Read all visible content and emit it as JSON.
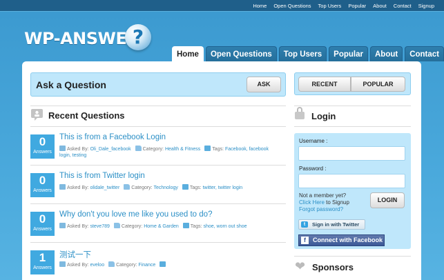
{
  "topnav": [
    "Home",
    "Open Questions",
    "Top Users",
    "Popular",
    "About",
    "Contact",
    "Signup"
  ],
  "logo": {
    "text": "WP-ANSWERS",
    "mark": "?"
  },
  "mainnav": [
    {
      "label": "Home",
      "active": true
    },
    {
      "label": "Open Questions",
      "active": false
    },
    {
      "label": "Top Users",
      "active": false
    },
    {
      "label": "Popular",
      "active": false
    },
    {
      "label": "About",
      "active": false
    },
    {
      "label": "Contact",
      "active": false
    }
  ],
  "ask": {
    "title": "Ask a Question",
    "button": "ASK"
  },
  "recent": {
    "heading": "Recent Questions"
  },
  "questions": [
    {
      "count": "0",
      "count_label": "Answers",
      "title": "This is from a Facebook Login",
      "asked_by_label": "Asked By:",
      "user": "Oli_Dale_facebook",
      "category_label": "Category:",
      "category": "Health & Fitness",
      "tags_label": "Tags:",
      "tags": "Facebook, facebook login, testing"
    },
    {
      "count": "0",
      "count_label": "Answers",
      "title": "This is from Twitter login",
      "asked_by_label": "Asked By:",
      "user": "olidale_twitter",
      "category_label": "Category:",
      "category": "Technology",
      "tags_label": "Tags:",
      "tags": "twitter, twitter login"
    },
    {
      "count": "0",
      "count_label": "Answers",
      "title": "Why don't you love me like you used to do?",
      "asked_by_label": "Asked By:",
      "user": "steve789",
      "category_label": "Category:",
      "category": "Home & Garden",
      "tags_label": "Tags:",
      "tags": "shoe, worn out shoe"
    },
    {
      "count": "1",
      "count_label": "Answers",
      "title": "测试一下",
      "asked_by_label": "Asked By:",
      "user": "eveloo",
      "category_label": "Category:",
      "category": "Finance",
      "tags_label": "",
      "tags": ""
    }
  ],
  "sidebar": {
    "tabs": {
      "recent": "RECENT",
      "popular": "POPULAR"
    },
    "login": {
      "heading": "Login",
      "username_label": "Username :",
      "password_label": "Password :",
      "not_member": "Not a member yet?",
      "click_here": "Click Here",
      "to_signup": " to Signup",
      "forgot": "Forgot password?",
      "login_button": "LOGIN",
      "twitter": "Sign in with Twitter",
      "facebook": "Connect with Facebook"
    },
    "sponsors_heading": "Sponsors"
  }
}
